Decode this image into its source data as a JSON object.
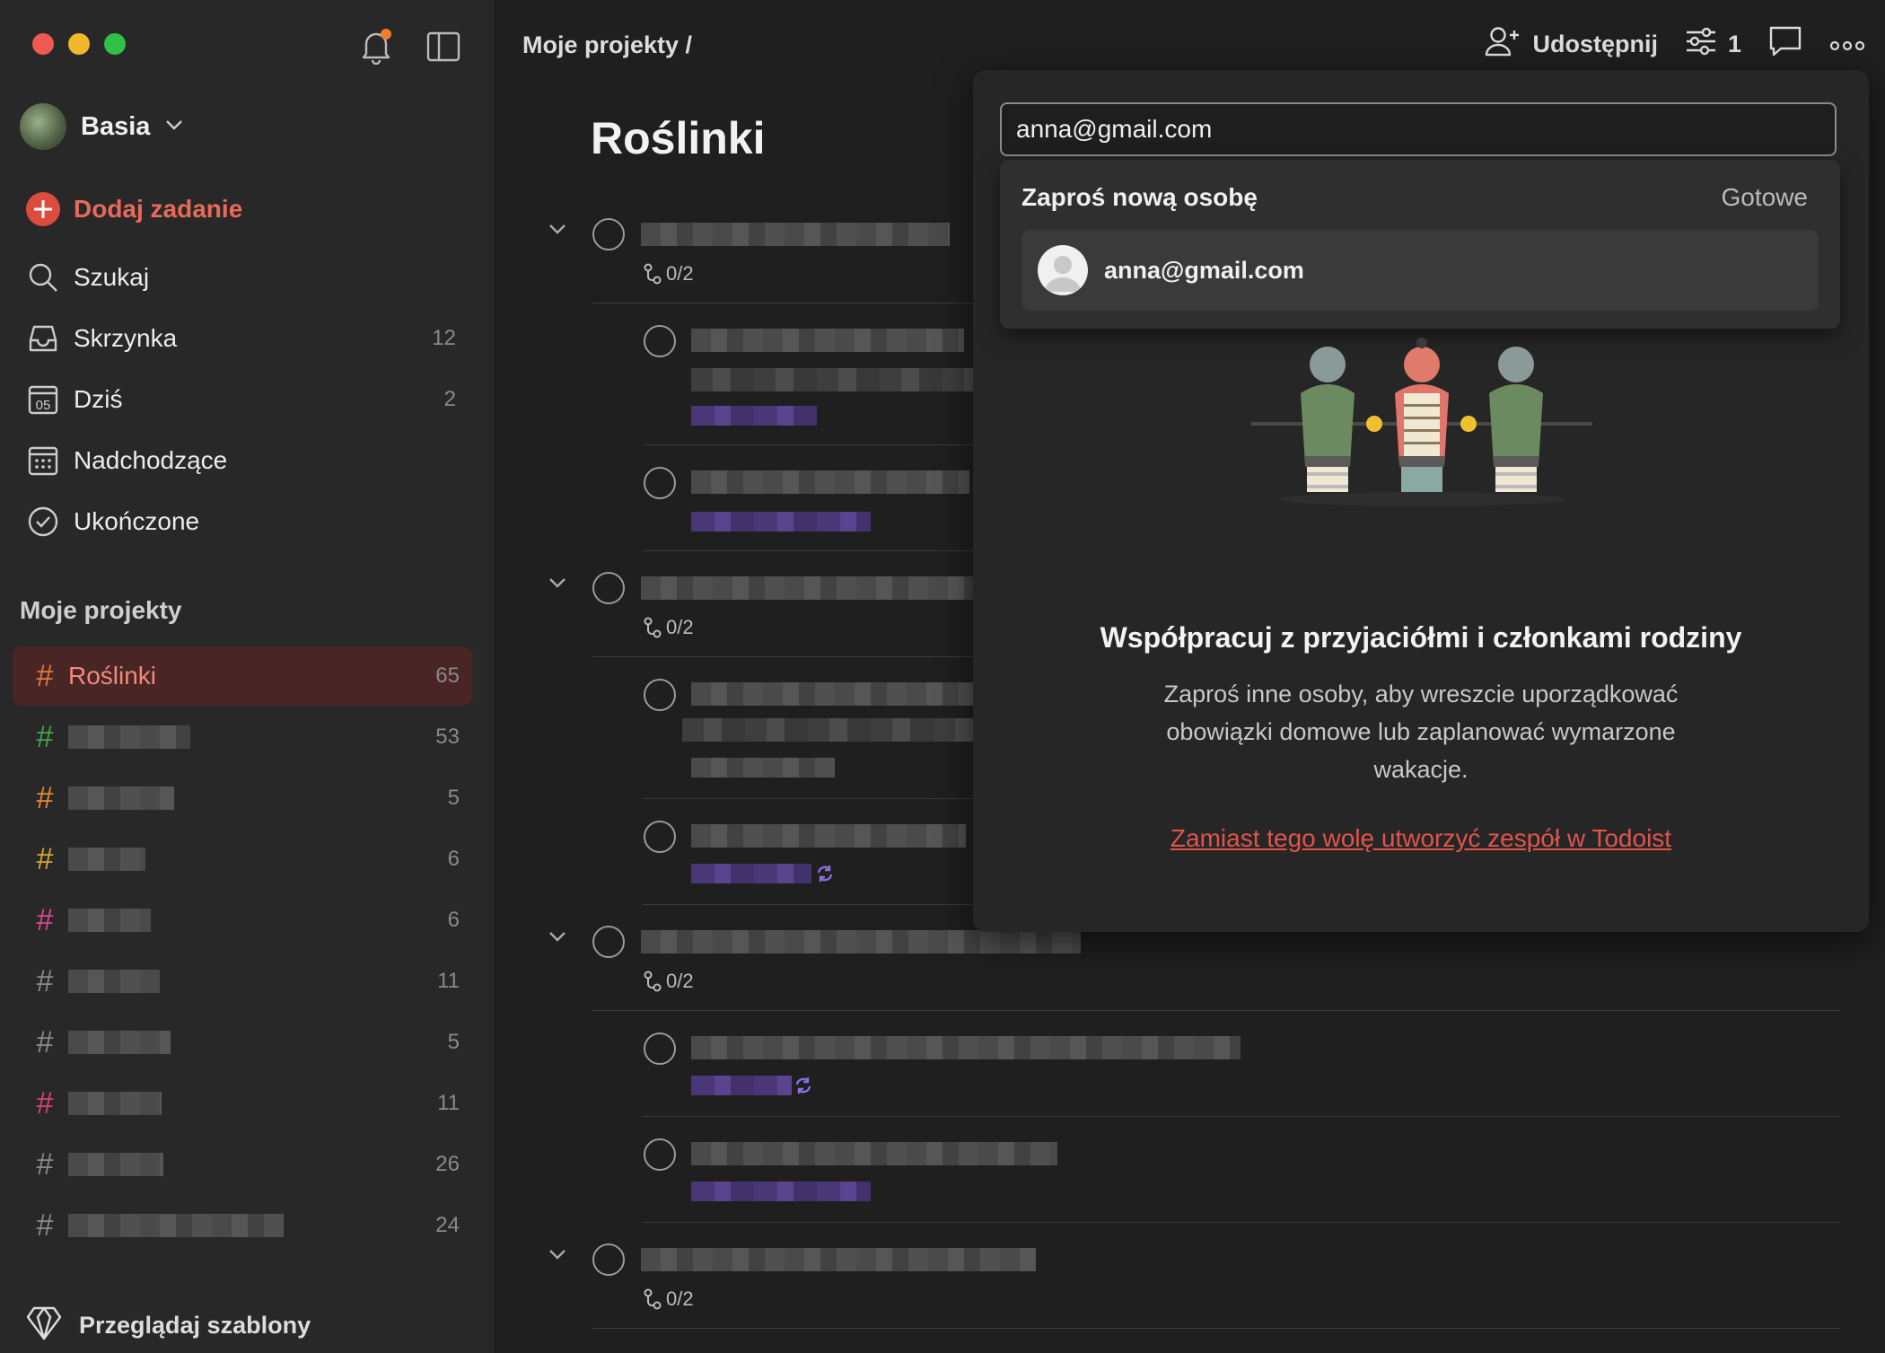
{
  "window": {
    "traffic_lights": {
      "close": "#ee5a52",
      "minimize": "#f2b62f",
      "zoom": "#30c046"
    },
    "notification_dot_color": "#f07d2d"
  },
  "sidebar": {
    "user_name": "Basia",
    "add_task_label": "Dodaj zadanie",
    "nav": [
      {
        "label": "Szukaj",
        "count": "",
        "icon": "search-icon"
      },
      {
        "label": "Skrzynka",
        "count": "12",
        "icon": "inbox-icon"
      },
      {
        "label": "Dziś",
        "count": "2",
        "icon": "calendar-today-icon"
      },
      {
        "label": "Nadchodzące",
        "count": "",
        "icon": "calendar-upcoming-icon"
      },
      {
        "label": "Ukończone",
        "count": "",
        "icon": "check-circle-icon"
      }
    ],
    "today_icon_text": "05",
    "projects_header": "Moje projekty",
    "projects": [
      {
        "name": "Roślinki",
        "count": "65",
        "color": "#e07a3a",
        "active": true
      },
      {
        "name": "",
        "count": "53",
        "color": "#4aa34a",
        "blur_w": 100
      },
      {
        "name": "",
        "count": "5",
        "color": "#e58b2f",
        "blur_w": 88
      },
      {
        "name": "",
        "count": "6",
        "color": "#d9a62b",
        "blur_w": 64
      },
      {
        "name": "",
        "count": "6",
        "color": "#d44a8e",
        "blur_w": 68
      },
      {
        "name": "",
        "count": "11",
        "color": "#8a8a8a",
        "blur_w": 76
      },
      {
        "name": "",
        "count": "5",
        "color": "#8a8a8a",
        "blur_w": 84
      },
      {
        "name": "",
        "count": "11",
        "color": "#d6446a",
        "blur_w": 78
      },
      {
        "name": "",
        "count": "26",
        "color": "#8a8a8a",
        "blur_w": 78
      },
      {
        "name": "",
        "count": "24",
        "color": "#8a8a8a",
        "blur_w": 178
      }
    ],
    "templates_label": "Przeglądaj szablony"
  },
  "header": {
    "breadcrumb": "Moje projekty /",
    "share_label": "Udostępnij",
    "filter_count": "1"
  },
  "project": {
    "title": "Roślinki",
    "subtask_counter": "0/2"
  },
  "share_popup": {
    "email_value": "anna@gmail.com",
    "invite_header": "Zaproś nową osobę",
    "done_label": "Gotowe",
    "suggestion_email": "anna@gmail.com",
    "collab_title": "Współpracuj z przyjaciółmi i członkami rodziny",
    "collab_body": "Zaproś inne osoby, aby wreszcie uporządkować obowiązki domowe lub zaplanować wymarzone wakacje.",
    "team_link": "Zamiast tego wolę utworzyć zespół w Todoist"
  }
}
